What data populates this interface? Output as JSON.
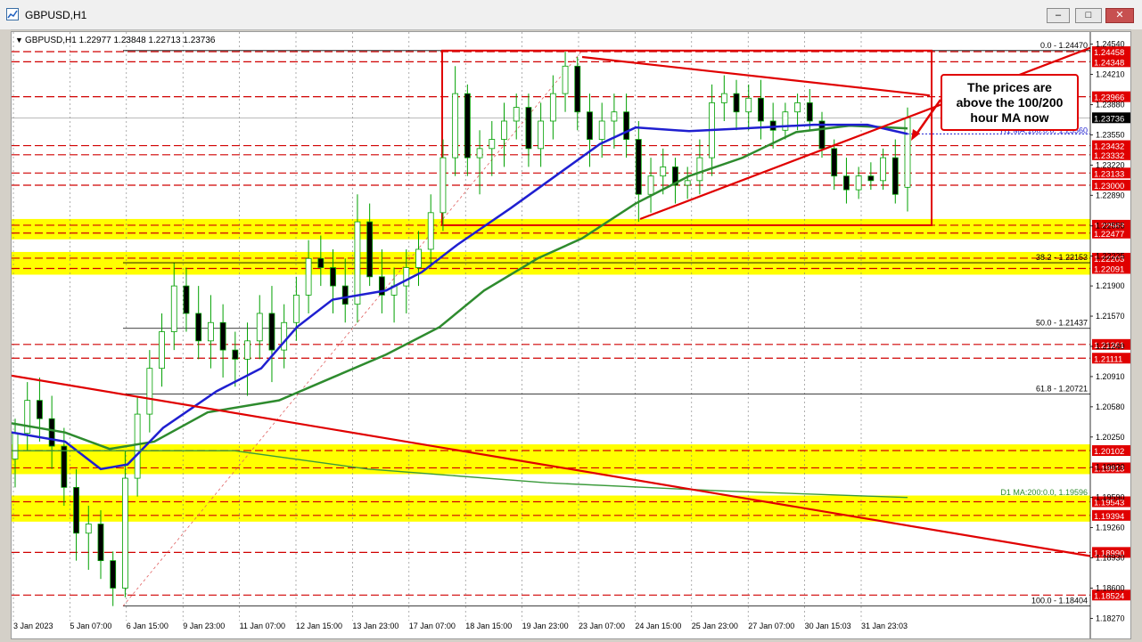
{
  "window": {
    "title": "GBPUSD,H1",
    "min_label": "–",
    "max_label": "□",
    "close_label": "✕"
  },
  "header": {
    "arrow": "▼",
    "info": "GBPUSD,H1  1.22977 1.23848 1.22713 1.23736"
  },
  "callout": {
    "line1": "The prices are",
    "line2": "above the 100/200",
    "line3": "hour MA now"
  },
  "chart_data": {
    "type": "candlestick",
    "symbol": "GBPUSD",
    "timeframe": "H1",
    "ohlc_last": {
      "open": 1.22977,
      "high": 1.23848,
      "low": 1.22713,
      "close": 1.23736
    },
    "ylim": [
      1.18245,
      1.24575
    ],
    "yticks": [
      1.2454,
      1.2421,
      1.2388,
      1.2355,
      1.2322,
      1.2289,
      1.22555,
      1.22225,
      1.219,
      1.2157,
      1.2124,
      1.2091,
      1.2058,
      1.2025,
      1.1992,
      1.1959,
      1.1926,
      1.1893,
      1.186,
      1.1827
    ],
    "xticks": [
      "3 Jan 2023",
      "5 Jan 07:00",
      "6 Jan 15:00",
      "9 Jan 23:00",
      "11 Jan 07:00",
      "12 Jan 15:00",
      "13 Jan 23:00",
      "17 Jan 07:00",
      "18 Jan 15:00",
      "19 Jan 23:00",
      "23 Jan 07:00",
      "24 Jan 15:00",
      "25 Jan 23:00",
      "27 Jan 07:00",
      "30 Jan 15:03",
      "31 Jan 23:03"
    ],
    "price_levels": [
      {
        "label": "1.24458",
        "value": 1.24458
      },
      {
        "label": "1.24348",
        "value": 1.24348
      },
      {
        "label": "1.23966",
        "value": 1.23966
      },
      {
        "label": "1.23432",
        "value": 1.23432
      },
      {
        "label": "1.23332",
        "value": 1.23332
      },
      {
        "label": "1.23133",
        "value": 1.23133
      },
      {
        "label": "1.23000",
        "value": 1.23
      },
      {
        "label": "1.22563",
        "value": 1.22563
      },
      {
        "label": "1.22477",
        "value": 1.22477
      },
      {
        "label": "1.22203",
        "value": 1.22203
      },
      {
        "label": "1.22091",
        "value": 1.22091
      },
      {
        "label": "1.21261",
        "value": 1.21261
      },
      {
        "label": "1.21111",
        "value": 1.21111
      },
      {
        "label": "1.20102",
        "value": 1.20102
      },
      {
        "label": "1.19913",
        "value": 1.19913
      },
      {
        "label": "1.19543",
        "value": 1.19543
      },
      {
        "label": "1.19394",
        "value": 1.19394
      },
      {
        "label": "1.18990",
        "value": 1.1899
      },
      {
        "label": "1.18524",
        "value": 1.18524
      }
    ],
    "current_price": {
      "label": "1.23736",
      "value": 1.23736
    },
    "fib_levels": [
      {
        "label": "0.0 - 1.24470",
        "value": 1.2447
      },
      {
        "label": "38.2 - 1.22153",
        "value": 1.22153
      },
      {
        "label": "50.0 - 1.21437",
        "value": 1.21437
      },
      {
        "label": "61.8 - 1.20721",
        "value": 1.20721
      },
      {
        "label": "100.0 - 1.18404",
        "value": 1.18404
      }
    ],
    "ma_labels": {
      "h1_ma100": "H1 MA:100:0.0, 1.23560",
      "d1_ma200": "D1 MA:200:0.0, 1.19596"
    },
    "yellow_zones": [
      [
        1.22477,
        1.22563
      ],
      [
        1.22091,
        1.22203
      ],
      [
        1.19913,
        1.20102
      ],
      [
        1.19394,
        1.19543
      ]
    ],
    "candles": [
      [
        1.2001,
        1.2045,
        1.197,
        1.2029
      ],
      [
        1.2029,
        1.2085,
        1.201,
        1.2065
      ],
      [
        1.2065,
        1.209,
        1.202,
        1.2045
      ],
      [
        1.2045,
        1.207,
        1.199,
        1.2015
      ],
      [
        1.2015,
        1.2035,
        1.195,
        1.197
      ],
      [
        1.197,
        1.199,
        1.189,
        1.192
      ],
      [
        1.192,
        1.195,
        1.188,
        1.193
      ],
      [
        1.193,
        1.1945,
        1.187,
        1.189
      ],
      [
        1.189,
        1.19,
        1.18404,
        1.186
      ],
      [
        1.186,
        1.201,
        1.185,
        1.198
      ],
      [
        1.198,
        1.207,
        1.196,
        1.205
      ],
      [
        1.205,
        1.212,
        1.203,
        1.21
      ],
      [
        1.21,
        1.216,
        1.208,
        1.214
      ],
      [
        1.214,
        1.2215,
        1.212,
        1.219
      ],
      [
        1.219,
        1.221,
        1.214,
        1.216
      ],
      [
        1.216,
        1.219,
        1.211,
        1.213
      ],
      [
        1.213,
        1.218,
        1.21,
        1.215
      ],
      [
        1.215,
        1.217,
        1.209,
        1.212
      ],
      [
        1.212,
        1.214,
        1.208,
        1.211
      ],
      [
        1.211,
        1.215,
        1.207,
        1.213
      ],
      [
        1.213,
        1.218,
        1.211,
        1.216
      ],
      [
        1.216,
        1.219,
        1.2085,
        1.212
      ],
      [
        1.212,
        1.217,
        1.21,
        1.215
      ],
      [
        1.215,
        1.22,
        1.213,
        1.218
      ],
      [
        1.218,
        1.224,
        1.216,
        1.222
      ],
      [
        1.222,
        1.2245,
        1.219,
        1.221
      ],
      [
        1.221,
        1.223,
        1.216,
        1.219
      ],
      [
        1.219,
        1.222,
        1.215,
        1.217
      ],
      [
        1.217,
        1.229,
        1.215,
        1.226
      ],
      [
        1.226,
        1.228,
        1.219,
        1.22
      ],
      [
        1.22,
        1.223,
        1.216,
        1.218
      ],
      [
        1.218,
        1.221,
        1.215,
        1.219
      ],
      [
        1.219,
        1.223,
        1.216,
        1.221
      ],
      [
        1.221,
        1.225,
        1.219,
        1.223
      ],
      [
        1.223,
        1.229,
        1.221,
        1.227
      ],
      [
        1.227,
        1.235,
        1.225,
        1.233
      ],
      [
        1.233,
        1.243,
        1.231,
        1.24
      ],
      [
        1.24,
        1.241,
        1.231,
        1.233
      ],
      [
        1.233,
        1.236,
        1.229,
        1.234
      ],
      [
        1.234,
        1.237,
        1.231,
        1.235
      ],
      [
        1.235,
        1.239,
        1.232,
        1.237
      ],
      [
        1.237,
        1.24,
        1.235,
        1.2385
      ],
      [
        1.2385,
        1.24,
        1.232,
        1.234
      ],
      [
        1.234,
        1.239,
        1.232,
        1.237
      ],
      [
        1.237,
        1.242,
        1.235,
        1.24
      ],
      [
        1.24,
        1.24458,
        1.238,
        1.243
      ],
      [
        1.243,
        1.244,
        1.236,
        1.238
      ],
      [
        1.238,
        1.24,
        1.232,
        1.235
      ],
      [
        1.235,
        1.239,
        1.233,
        1.237
      ],
      [
        1.237,
        1.24,
        1.234,
        1.238
      ],
      [
        1.238,
        1.24,
        1.233,
        1.235
      ],
      [
        1.235,
        1.237,
        1.226,
        1.229
      ],
      [
        1.229,
        1.233,
        1.227,
        1.231
      ],
      [
        1.231,
        1.234,
        1.229,
        1.232
      ],
      [
        1.232,
        1.233,
        1.228,
        1.23
      ],
      [
        1.23,
        1.232,
        1.2285,
        1.2305
      ],
      [
        1.2305,
        1.235,
        1.229,
        1.233
      ],
      [
        1.233,
        1.241,
        1.231,
        1.239
      ],
      [
        1.239,
        1.242,
        1.237,
        1.24
      ],
      [
        1.24,
        1.2415,
        1.236,
        1.238
      ],
      [
        1.238,
        1.241,
        1.236,
        1.2395
      ],
      [
        1.2395,
        1.2415,
        1.235,
        1.237
      ],
      [
        1.237,
        1.239,
        1.234,
        1.236
      ],
      [
        1.236,
        1.239,
        1.235,
        1.238
      ],
      [
        1.238,
        1.24,
        1.236,
        1.239
      ],
      [
        1.239,
        1.2405,
        1.236,
        1.237
      ],
      [
        1.237,
        1.238,
        1.233,
        1.234
      ],
      [
        1.234,
        1.235,
        1.2295,
        1.231
      ],
      [
        1.231,
        1.233,
        1.228,
        1.2295
      ],
      [
        1.2295,
        1.232,
        1.2285,
        1.231
      ],
      [
        1.231,
        1.2325,
        1.2295,
        1.2305
      ],
      [
        1.2305,
        1.234,
        1.2295,
        1.233
      ],
      [
        1.233,
        1.235,
        1.228,
        1.229
      ],
      [
        1.22977,
        1.23848,
        1.22713,
        1.23736
      ]
    ]
  }
}
